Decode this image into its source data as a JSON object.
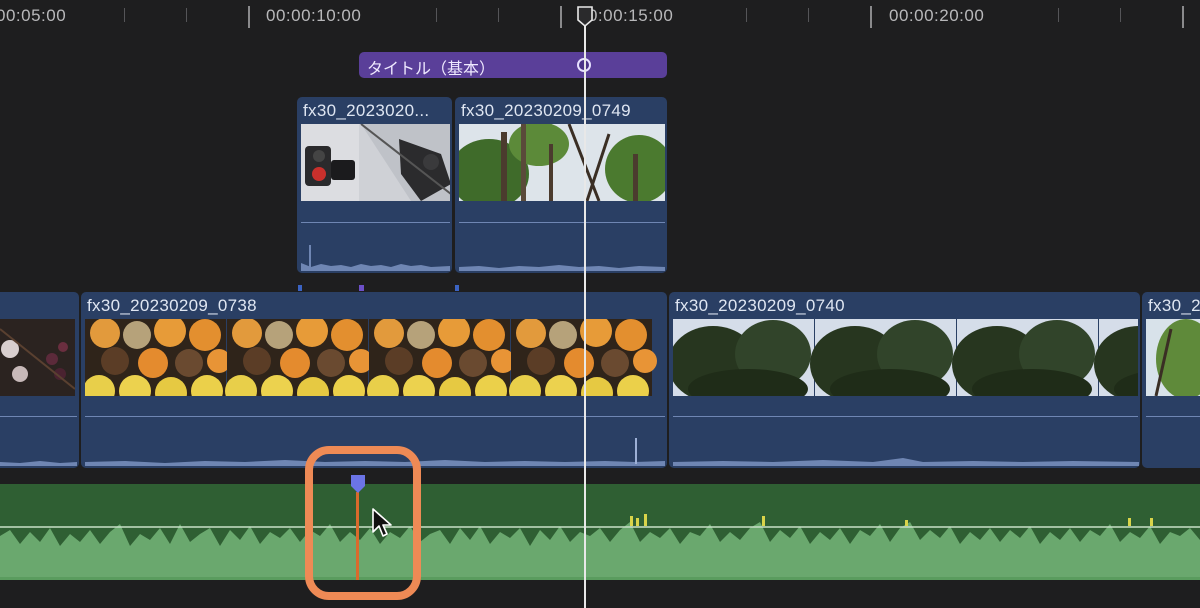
{
  "ruler": {
    "timecodes": [
      "00:05:00",
      "00:00:10:00",
      "00:00:15:00",
      "00:00:20:00"
    ]
  },
  "title_clip": {
    "label": "タイトル（基本）"
  },
  "connected_clips": [
    {
      "name": "fx30_2023020..."
    },
    {
      "name": "fx30_20230209_0749"
    }
  ],
  "primary_clips": [
    {
      "name": ""
    },
    {
      "name": "fx30_20230209_0738"
    },
    {
      "name": "fx30_20230209_0740"
    },
    {
      "name": "fx30_2"
    }
  ],
  "colors": {
    "background": "#1e1e1f",
    "video_clip": "#2a3f64",
    "title_clip": "#5a3f99",
    "music_lane": "#2f5f33",
    "waveform": "#6aa86e",
    "marker": "#6b74e6",
    "highlight": "#ee8a55"
  }
}
